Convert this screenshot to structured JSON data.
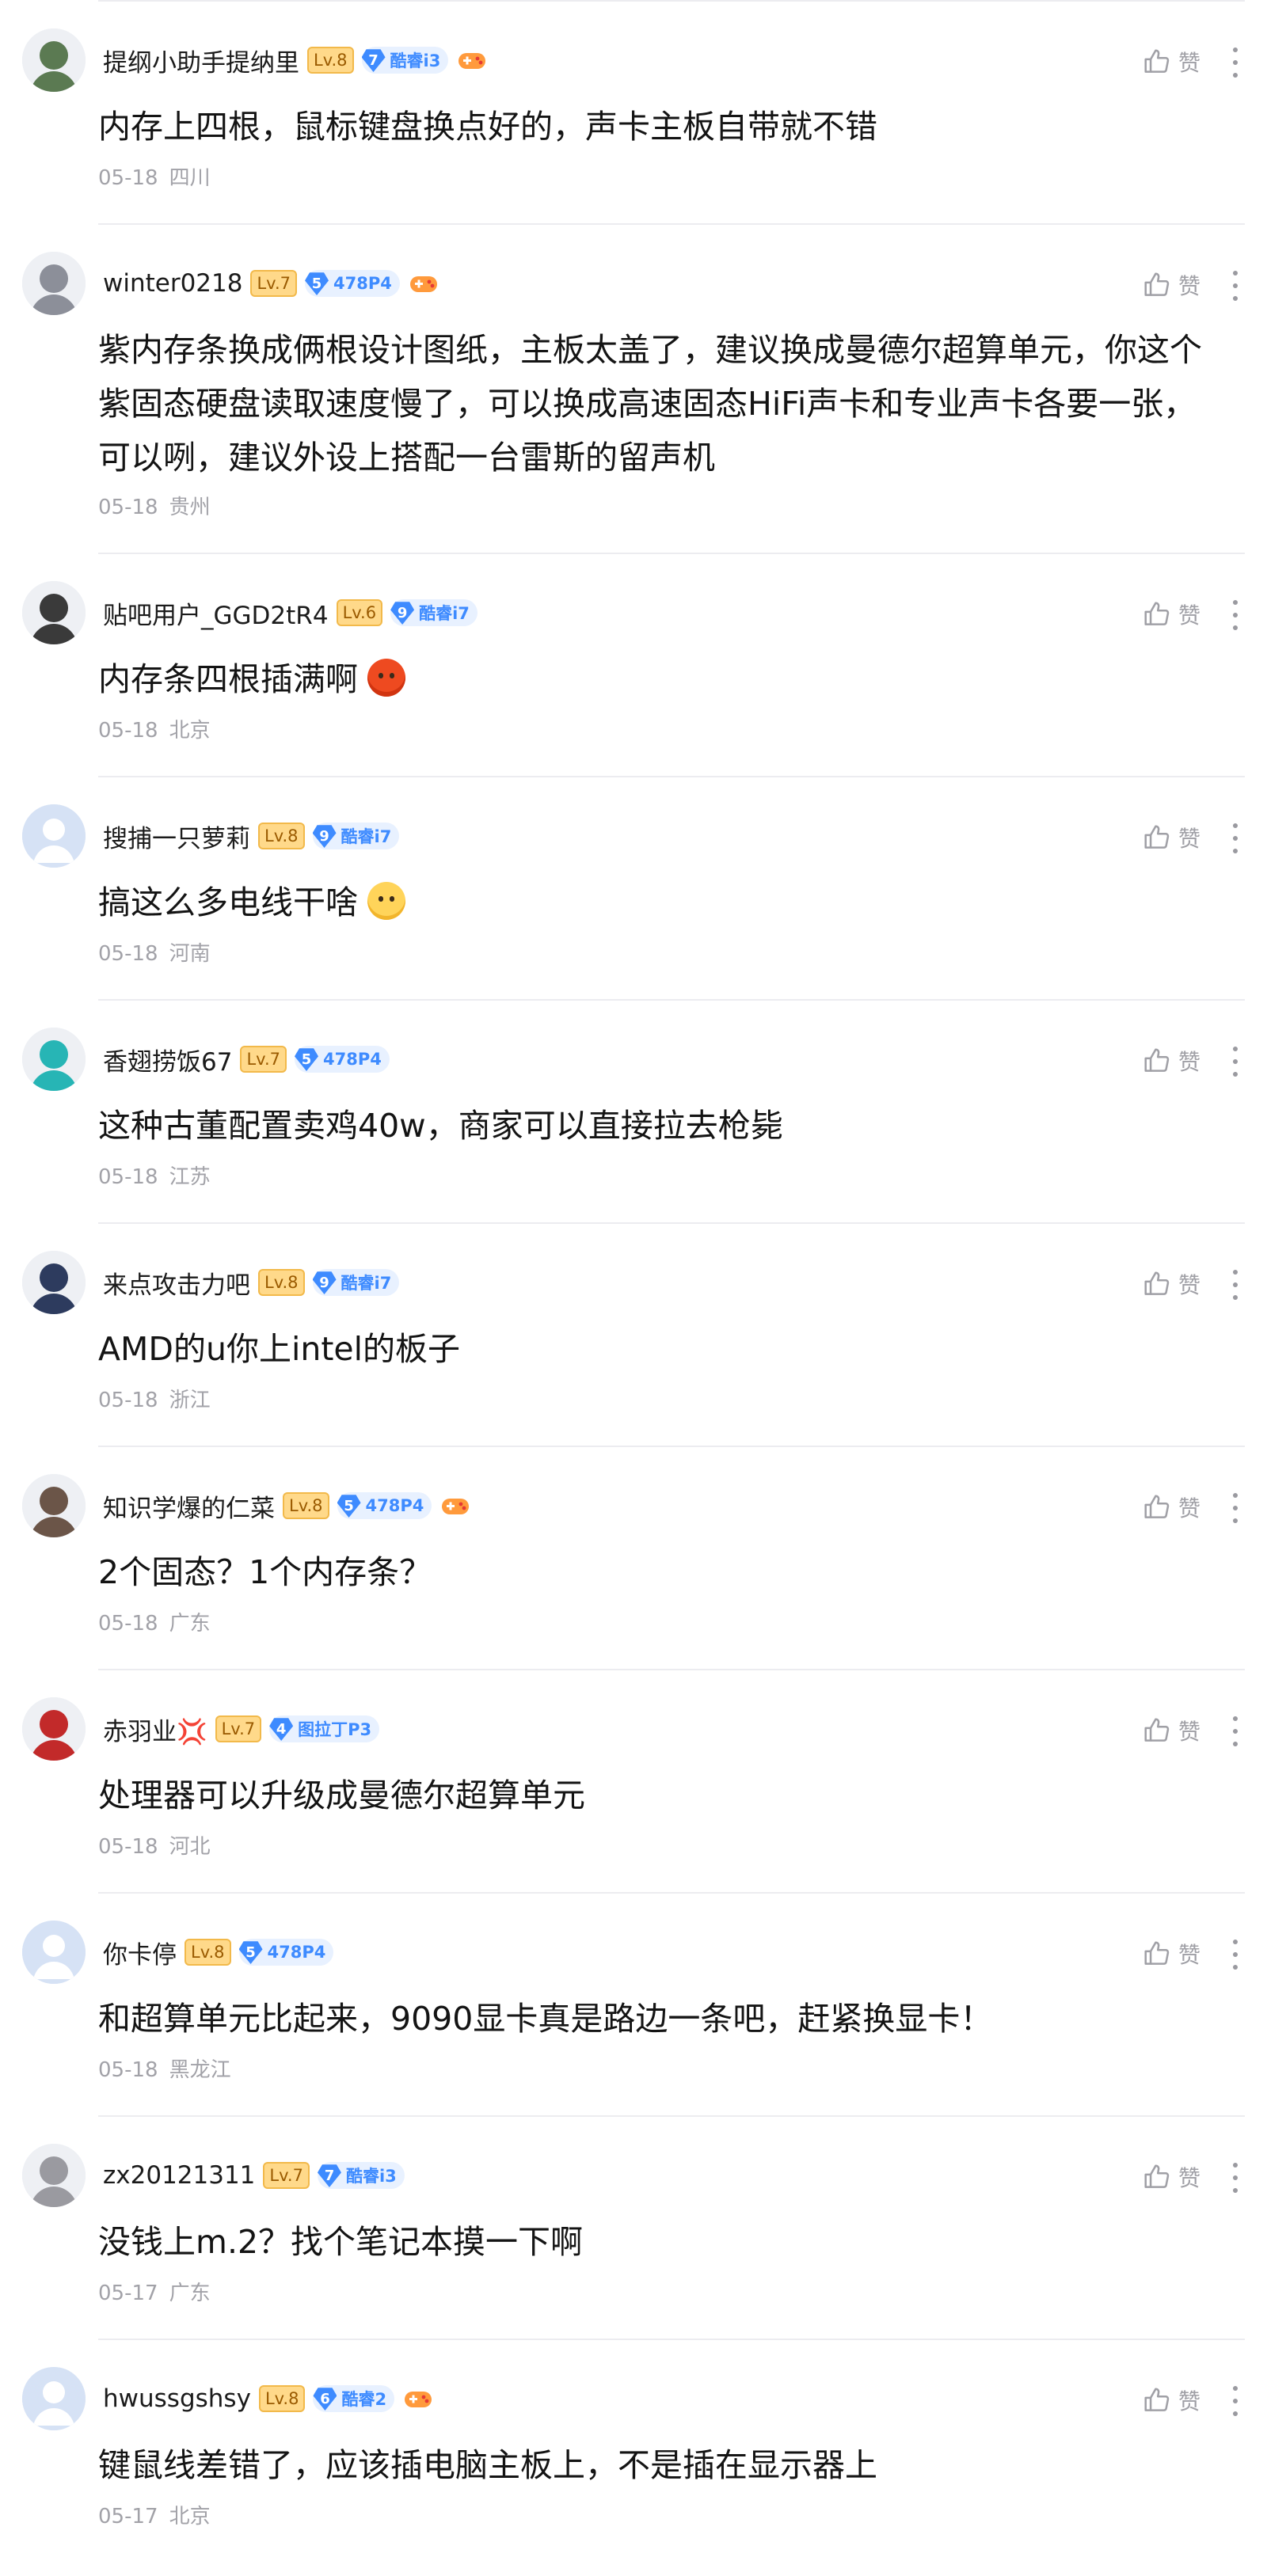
{
  "theme": {
    "text": "#141414",
    "meta": "#a2a2a8",
    "level_bg": "#ffd98a",
    "badge_blue": "#3e8bff",
    "divider": "#ececf0"
  },
  "like_label": "赞",
  "comments": [
    {
      "user": "提纲小助手提纳里",
      "level": "Lv.8",
      "badge_num": "7",
      "badge_name": "酷睿i3",
      "gamepad": true,
      "text": "内存上四根，鼠标键盘换点好的，声卡主板自带就不错",
      "date": "05-18",
      "region": "四川",
      "lines": 1,
      "avatar_color": "#5b7a52"
    },
    {
      "user": "winter0218",
      "level": "Lv.7",
      "badge_num": "5",
      "badge_name": "478P4",
      "gamepad": true,
      "text": "紫内存条换成俩根设计图纸，主板太盖了，建议换成曼德尔超算单元，你这个紫固态硬盘读取速度慢了，可以换成高速固态HiFi声卡和专业声卡各要一张，可以咧，建议外设上搭配一台雷斯的留声机",
      "date": "05-18",
      "region": "贵州",
      "lines": 3,
      "avatar_color": "#8c8f99"
    },
    {
      "user": "贴吧用户_GGD2tR4",
      "level": "Lv.6",
      "badge_num": "9",
      "badge_name": "酷睿i7",
      "gamepad": false,
      "text": "内存条四根插满啊",
      "emoji": "angry",
      "date": "05-18",
      "region": "北京",
      "lines": 1,
      "avatar_color": "#3a3a3a"
    },
    {
      "user": "搜捕一只萝莉",
      "level": "Lv.8",
      "badge_num": "9",
      "badge_name": "酷睿i7",
      "gamepad": false,
      "text": "搞这么多电线干啥",
      "emoji": "meh",
      "date": "05-18",
      "region": "河南",
      "lines": 1,
      "avatar_color": "default"
    },
    {
      "user": "香翅捞饭67",
      "level": "Lv.7",
      "badge_num": "5",
      "badge_name": "478P4",
      "gamepad": false,
      "text": "这种古董配置卖鸡40w，商家可以直接拉去枪毙",
      "date": "05-18",
      "region": "江苏",
      "lines": 1,
      "avatar_color": "#27b5b5"
    },
    {
      "user": "来点攻击力吧",
      "level": "Lv.8",
      "badge_num": "9",
      "badge_name": "酷睿i7",
      "gamepad": false,
      "text": "AMD的u你上intel的板子",
      "date": "05-18",
      "region": "浙江",
      "lines": 1,
      "avatar_color": "#2d3b5e"
    },
    {
      "user": "知识学爆的仁菜",
      "level": "Lv.8",
      "badge_num": "5",
      "badge_name": "478P4",
      "gamepad": true,
      "text": "2个固态？1个内存条？",
      "date": "05-18",
      "region": "广东",
      "lines": 1,
      "avatar_color": "#6b5548"
    },
    {
      "user": "赤羽业💢",
      "level": "Lv.7",
      "badge_num": "4",
      "badge_name": "图拉丁P3",
      "gamepad": false,
      "text": "处理器可以升级成曼德尔超算单元",
      "date": "05-18",
      "region": "河北",
      "lines": 1,
      "avatar_color": "#c22a2a"
    },
    {
      "user": "你卡停",
      "level": "Lv.8",
      "badge_num": "5",
      "badge_name": "478P4",
      "gamepad": false,
      "text": "和超算单元比起来，9090显卡真是路边一条吧，赶紧换显卡！",
      "date": "05-18",
      "region": "黑龙江",
      "lines": 1,
      "avatar_color": "default"
    },
    {
      "user": "zx20121311",
      "level": "Lv.7",
      "badge_num": "7",
      "badge_name": "酷睿i3",
      "gamepad": false,
      "text": "没钱上m.2？找个笔记本摸一下啊",
      "date": "05-17",
      "region": "广东",
      "lines": 1,
      "avatar_color": "#9a9aa0"
    },
    {
      "user": "hwussgshsy",
      "level": "Lv.8",
      "badge_num": "6",
      "badge_name": "酷睿2",
      "gamepad": true,
      "text": "键鼠线差错了，应该插电脑主板上，不是插在显示器上",
      "date": "05-17",
      "region": "北京",
      "lines": 1,
      "avatar_color": "default"
    }
  ]
}
